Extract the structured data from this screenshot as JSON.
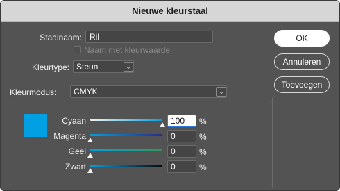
{
  "dialog": {
    "title": "Nieuwe kleurstaal"
  },
  "form": {
    "swatch_name_label": "Staalnaam:",
    "swatch_name_value": "Ril",
    "name_with_value_label": "Naam met kleurwaarde",
    "color_type_label": "Kleurtype:",
    "color_type_value": "Steun",
    "color_mode_label": "Kleurmodus:",
    "color_mode_value": "CMYK"
  },
  "buttons": {
    "ok": "OK",
    "cancel": "Annuleren",
    "add": "Toevoegen"
  },
  "swatch_color": "#00a0e3",
  "channels": [
    {
      "name": "Cyaan",
      "value": "100",
      "unit": "%",
      "level": 1.0,
      "track_color": "#4fc3f7"
    },
    {
      "name": "Magenta",
      "value": "0",
      "unit": "%",
      "level": 0.0,
      "track_color": "#3a3aa0"
    },
    {
      "name": "Geel",
      "value": "0",
      "unit": "%",
      "level": 0.0,
      "track_color": "#3aa05a"
    },
    {
      "name": "Zwart",
      "value": "0",
      "unit": "%",
      "level": 0.0,
      "track_color": "#0a3a50"
    }
  ],
  "icons": {
    "dropdown": "chevron-down-icon"
  }
}
